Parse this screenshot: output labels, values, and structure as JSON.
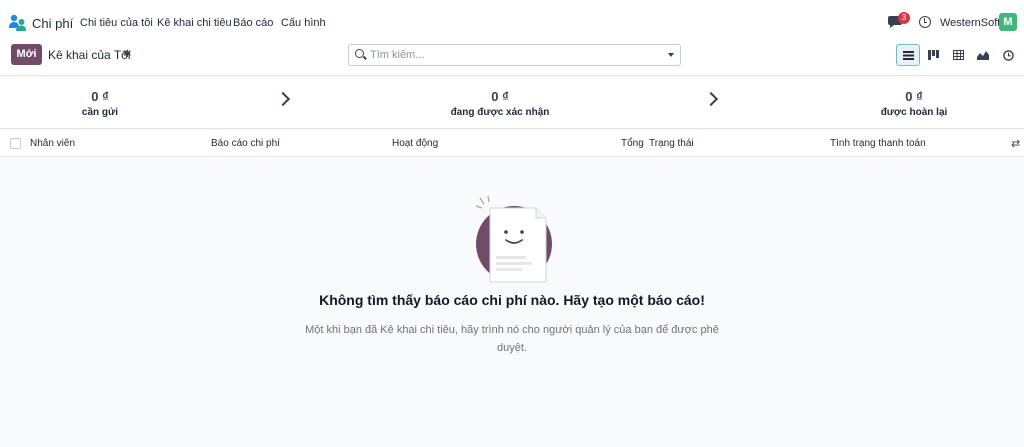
{
  "navbar": {
    "app_name": "Chi phí",
    "menu": [
      "Chi tiêu của tôi",
      "Kê khai chi tiêu",
      "Báo cáo",
      "Cấu hình"
    ],
    "message_count": "3",
    "company": "WesternSoft",
    "avatar_letter": "M"
  },
  "control": {
    "new_label": "Mới",
    "breadcrumb": "Kê khai của Tôi",
    "search_placeholder": "Tìm kiếm..."
  },
  "stages": [
    {
      "amount": "0 ₫",
      "label": "cần gửi"
    },
    {
      "amount": "0 ₫",
      "label": "đang được xác nhận"
    },
    {
      "amount": "0 ₫",
      "label": "được hoàn lại"
    }
  ],
  "columns": [
    "Nhân viên",
    "Báo cáo chi phí",
    "Hoạt động",
    "Tổng",
    "Trạng thái",
    "Tình trạng thanh toán"
  ],
  "empty": {
    "title": "Không tìm thấy báo cáo chi phí nào. Hãy tạo một báo cáo!",
    "text": "Một khi bạn đã Kê khai chi tiêu, hãy trình nó cho người quản lý của bạn để được phê duyệt."
  },
  "colors": {
    "brand": "#714b67",
    "avatar": "#3fb97b",
    "badge": "#dc3545"
  }
}
